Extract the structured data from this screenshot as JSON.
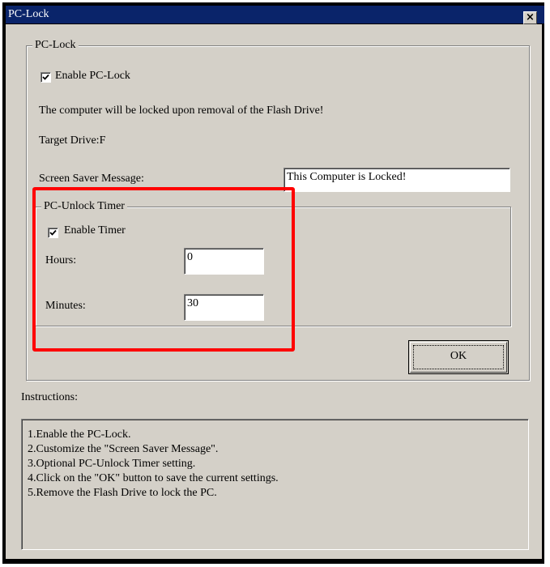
{
  "window": {
    "title": "PC-Lock",
    "close_glyph": "×"
  },
  "pclock_group": {
    "legend": "PC-Lock",
    "enable_label": "Enable PC-Lock",
    "enable_checked": true,
    "info_text": "The computer will be locked upon removal of the Flash Drive!",
    "target_drive": "Target Drive:F",
    "screen_saver_label": "Screen Saver Message:",
    "screen_saver_value": "This Computer is Locked!"
  },
  "timer_group": {
    "legend": "PC-Unlock Timer",
    "enable_label": "Enable Timer",
    "enable_checked": true,
    "hours_label": "Hours:",
    "hours_value": "0",
    "minutes_label": "Minutes:",
    "minutes_value": "30"
  },
  "ok_button": {
    "label": "OK"
  },
  "instructions": {
    "label": "Instructions:",
    "lines": [
      "1.Enable the PC-Lock.",
      "2.Customize the \"Screen Saver Message\".",
      "3.Optional PC-Unlock Timer setting.",
      "4.Click on the \"OK\" button to save the current settings.",
      "5.Remove the Flash Drive to lock the PC."
    ]
  },
  "colors": {
    "title_bar": "#0a246a",
    "dialog_face": "#d4d0c8",
    "highlight": "#ff0000"
  }
}
